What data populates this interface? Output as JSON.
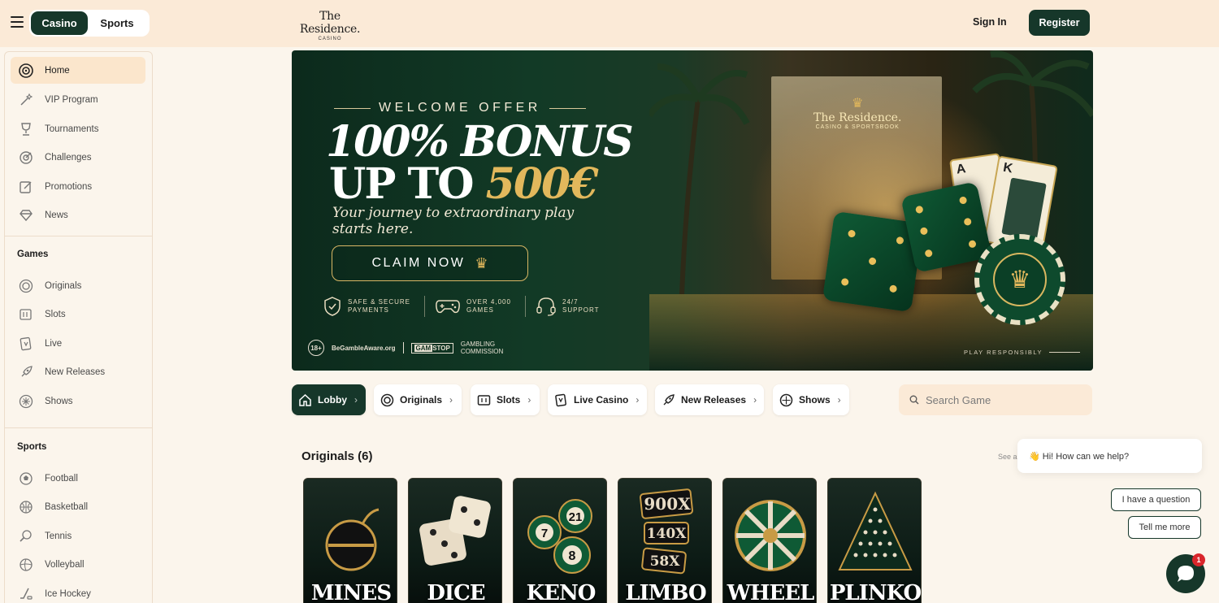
{
  "header": {
    "mode_tabs": [
      {
        "label": "Casino",
        "active": true
      },
      {
        "label": "Sports",
        "active": false
      }
    ],
    "logo": {
      "name": "The Residence.",
      "sub": "CASINO"
    },
    "signin_label": "Sign In",
    "register_label": "Register"
  },
  "sidebar": {
    "main": [
      {
        "label": "Home",
        "icon": "home-icon",
        "active": true
      },
      {
        "label": "VIP Program",
        "icon": "wand-icon"
      },
      {
        "label": "Tournaments",
        "icon": "trophy-icon"
      },
      {
        "label": "Challenges",
        "icon": "target-icon"
      },
      {
        "label": "Promotions",
        "icon": "edit-icon"
      },
      {
        "label": "News",
        "icon": "diamond-icon"
      }
    ],
    "games_title": "Games",
    "games": [
      {
        "label": "Originals",
        "icon": "originals-icon"
      },
      {
        "label": "Slots",
        "icon": "slots-icon"
      },
      {
        "label": "Live",
        "icon": "live-icon"
      },
      {
        "label": "New Releases",
        "icon": "rocket-icon"
      },
      {
        "label": "Shows",
        "icon": "shows-icon"
      }
    ],
    "sports_title": "Sports",
    "sports": [
      {
        "label": "Football",
        "icon": "football-icon"
      },
      {
        "label": "Basketball",
        "icon": "basketball-icon"
      },
      {
        "label": "Tennis",
        "icon": "tennis-icon"
      },
      {
        "label": "Volleyball",
        "icon": "volleyball-icon"
      },
      {
        "label": "Ice Hockey",
        "icon": "ice-hockey-icon"
      }
    ]
  },
  "banner": {
    "welcome": "WELCOME OFFER",
    "headline1": "100% BONUS",
    "headline2_prefix": "UP TO ",
    "headline2_amount": "500€",
    "tagline": "Your journey to extraordinary play starts here.",
    "cta": "CLAIM NOW",
    "features": [
      {
        "text": "SAFE & SECURE PAYMENTS",
        "icon": "shield-icon"
      },
      {
        "text": "OVER 4,000 GAMES",
        "icon": "gamepad-icon"
      },
      {
        "text": "24/7 SUPPORT",
        "icon": "headset-icon"
      }
    ],
    "compliance": {
      "age": "18+",
      "begambleaware": "BeGambleAware.org",
      "gamstop_a": "GAM",
      "gamstop_b": "STOP",
      "commission": "GAMBLING COMMISSION"
    },
    "play_responsibly": "PLAY RESPONSIBLY",
    "sign_name": "The Residence.",
    "sign_sub": "CASINO & SPORTSBOOK"
  },
  "tabs": [
    {
      "label": "Lobby",
      "icon": "home-icon",
      "active": true
    },
    {
      "label": "Originals",
      "icon": "originals-icon"
    },
    {
      "label": "Slots",
      "icon": "slots-icon"
    },
    {
      "label": "Live Casino",
      "icon": "live-icon"
    },
    {
      "label": "New Releases",
      "icon": "rocket-icon"
    },
    {
      "label": "Shows",
      "icon": "shows-icon"
    }
  ],
  "search": {
    "placeholder": "Search Game"
  },
  "originals": {
    "title": "Originals (6)",
    "see_all": "See a",
    "games": [
      {
        "name": "MINES"
      },
      {
        "name": "DICE"
      },
      {
        "name": "KENO"
      },
      {
        "name": "LIMBO"
      },
      {
        "name": "WHEEL"
      },
      {
        "name": "PLINKO"
      }
    ]
  },
  "chat": {
    "greeting": "👋 Hi! How can we help?",
    "options": [
      "I have a question",
      "Tell me more"
    ],
    "unread": "1"
  },
  "colors": {
    "brand": "#16372a",
    "gold": "#e2b85c",
    "header_bg": "#fbead7",
    "page_bg": "#fbf5ec"
  }
}
